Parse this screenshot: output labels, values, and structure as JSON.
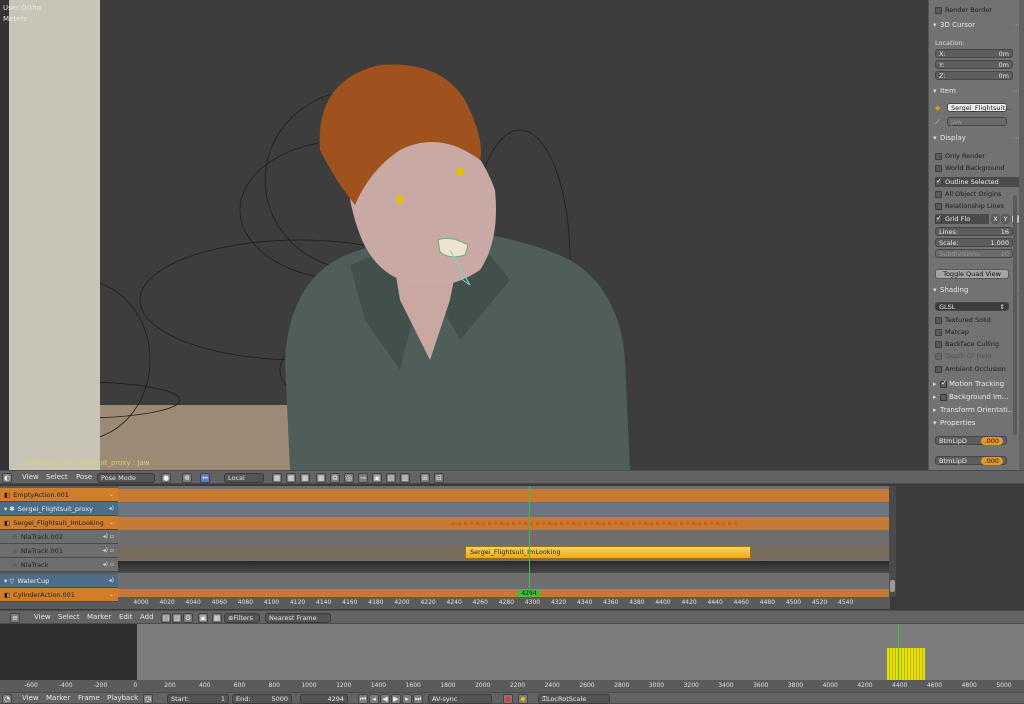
{
  "viewport": {
    "view_name": "User Ortho",
    "units": "Meters",
    "status": "(4294) Sergei_Flightsuit_proxy : Jaw"
  },
  "sidebar": {
    "render_border": "Render Border",
    "cursor_panel": "3D Cursor",
    "location_label": "Location:",
    "x_label": "X:",
    "x_val": "0m",
    "y_label": "Y:",
    "y_val": "0m",
    "z_label": "Z:",
    "z_val": "0m",
    "item_panel": "Item",
    "item_name": "Sergei_Flightsuit...",
    "bone_name": "Jaw",
    "display_panel": "Display",
    "display_options": [
      {
        "label": "Only Render",
        "checked": false
      },
      {
        "label": "World Background",
        "checked": false
      },
      {
        "label": "Outline Selected",
        "checked": true
      },
      {
        "label": "All Object Origins",
        "checked": false
      },
      {
        "label": "Relationship Lines",
        "checked": false
      }
    ],
    "grid_floor": "Grid Flo",
    "axis_x": "X",
    "axis_y": "Y",
    "axis_z": "Z",
    "lines_label": "Lines:",
    "lines_val": "16",
    "scale_label": "Scale:",
    "scale_val": "1.000",
    "subdiv_label": "Subdivisions:",
    "subdiv_val": "10",
    "toggle_quad": "Toggle Quad View",
    "shading_panel": "Shading",
    "shading_mode": "GLSL",
    "shading_options": [
      {
        "label": "Textured Solid",
        "checked": false
      },
      {
        "label": "Matcap",
        "checked": false
      },
      {
        "label": "Backface Culling",
        "checked": false
      },
      {
        "label": "Depth Of Field",
        "checked": false
      },
      {
        "label": "Ambient Occlusion",
        "checked": false
      }
    ],
    "motion_tracking": "Motion Tracking",
    "background_images": "Background Im...",
    "transform_orientations": "Transform Orientati...",
    "properties_panel": "Properties",
    "props": [
      {
        "label": "BtmLipD",
        "value": ".000"
      },
      {
        "label": "BtmLipD",
        "value": ".000"
      }
    ]
  },
  "header3d": {
    "menu": [
      "View",
      "Select",
      "Pose"
    ],
    "mode": "Pose Mode",
    "orientation": "Local"
  },
  "nla": {
    "rows": [
      {
        "label": "EmptyAction.001",
        "style": "orange"
      },
      {
        "label": "Sergei_Flightsuit_proxy",
        "style": "blue"
      },
      {
        "label": "Sergei_Flightsuit_ImLooking",
        "style": "orange"
      },
      {
        "label": "NlaTrack.002",
        "style": "gray"
      },
      {
        "label": "NlaTrack.001",
        "style": "gray"
      },
      {
        "label": "NlaTrack",
        "style": "gray"
      },
      {
        "label": "WaterCup",
        "style": "blue"
      },
      {
        "label": "CylinderAction.001",
        "style": "orange"
      }
    ],
    "strip_label": "Sergei_Flightsuit_ImLooking",
    "current_frame": "4294",
    "ticks": [
      "4000",
      "4020",
      "4040",
      "4060",
      "4080",
      "4100",
      "4120",
      "4140",
      "4160",
      "4180",
      "4200",
      "4220",
      "4240",
      "4260",
      "4280",
      "4300",
      "4320",
      "4340",
      "4360",
      "4380",
      "4400",
      "4420",
      "4440",
      "4460",
      "4480",
      "4500",
      "4520",
      "4540"
    ]
  },
  "nla_header": {
    "menu": [
      "View",
      "Select",
      "Marker",
      "Edit",
      "Add"
    ],
    "filters": "Filters",
    "snap": "Nearest Frame"
  },
  "timeline": {
    "ticks": [
      "-600",
      "-400",
      "-200",
      "0",
      "200",
      "400",
      "600",
      "800",
      "1000",
      "1200",
      "1400",
      "1600",
      "1800",
      "2000",
      "2200",
      "2400",
      "2600",
      "2800",
      "3000",
      "3200",
      "3400",
      "3600",
      "3800",
      "4000",
      "4200",
      "4400",
      "4600",
      "4800",
      "5000"
    ]
  },
  "tl_header": {
    "menu": [
      "View",
      "Marker",
      "Frame",
      "Playback"
    ],
    "start_label": "Start:",
    "start_val": "1",
    "end_label": "End:",
    "end_val": "5000",
    "frame_val": "4294",
    "sync": "AV-sync",
    "keying_set": "LocRotScale"
  },
  "colors": {
    "orange": "#d07d2e",
    "blue": "#4d6c87",
    "strip": "#f5b82a",
    "playhead": "#3fbf3f",
    "keys": "#e8e000"
  }
}
